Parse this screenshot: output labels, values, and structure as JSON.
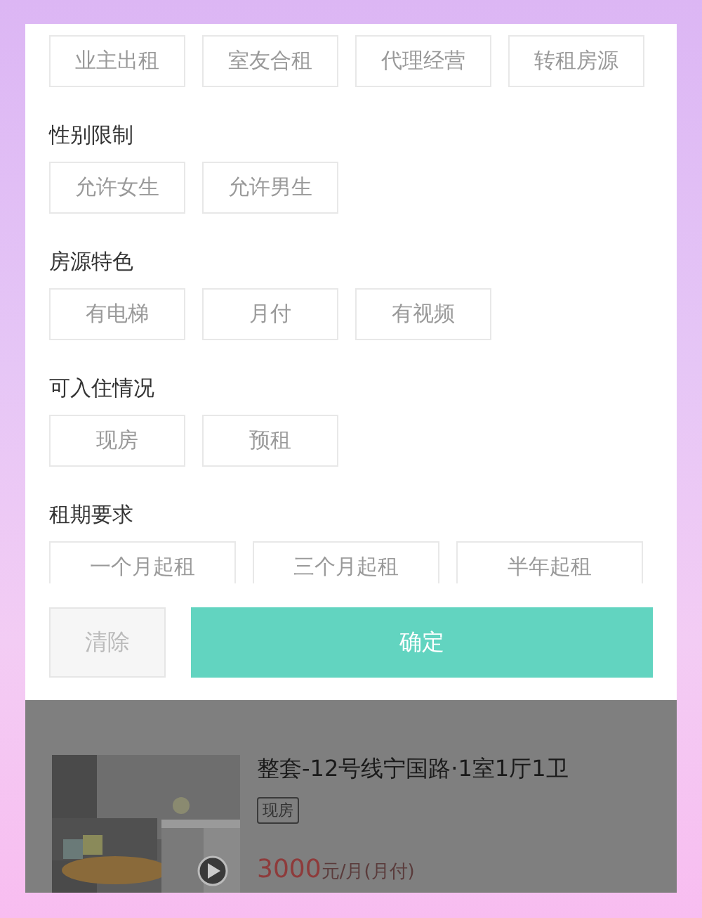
{
  "filter_sections": [
    {
      "chips": [
        {
          "label": "业主出租",
          "selected": false
        },
        {
          "label": "室友合租",
          "selected": false
        },
        {
          "label": "代理经营",
          "selected": false
        },
        {
          "label": "转租房源",
          "selected": false
        }
      ]
    },
    {
      "title": "性别限制",
      "chips": [
        {
          "label": "允许女生",
          "selected": false
        },
        {
          "label": "允许男生",
          "selected": false
        }
      ]
    },
    {
      "title": "房源特色",
      "chips": [
        {
          "label": "有电梯",
          "selected": false
        },
        {
          "label": "月付",
          "selected": false
        },
        {
          "label": "有视频",
          "selected": false
        }
      ]
    },
    {
      "title": "可入住情况",
      "chips": [
        {
          "label": "现房",
          "selected": false
        },
        {
          "label": "预租",
          "selected": false
        }
      ]
    },
    {
      "title": "租期要求",
      "chips": [
        {
          "label": "一个月起租",
          "selected": false
        },
        {
          "label": "三个月起租",
          "selected": false
        },
        {
          "label": "半年起租",
          "selected": false
        }
      ]
    }
  ],
  "footer": {
    "clear_button": "清除",
    "confirm_button": "确定"
  },
  "listing": {
    "title": "整套-12号线宁国路·1室1厅1卫",
    "tag": "现房",
    "price": "3000",
    "price_unit": "元/月(月付)",
    "has_video": true
  }
}
